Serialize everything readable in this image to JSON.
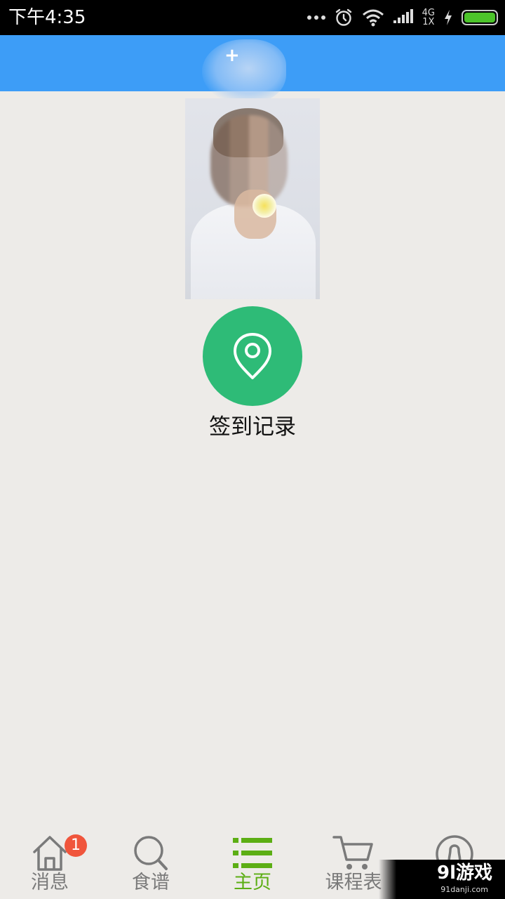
{
  "status_bar": {
    "time": "下午4:35",
    "network_top": "4G",
    "network_bottom": "1X",
    "icons": [
      "more-dots-icon",
      "alarm-icon",
      "wifi-icon",
      "signal-icon",
      "charging-icon",
      "battery-icon"
    ]
  },
  "header": {
    "title": "+"
  },
  "profile": {
    "photo": "profile-photo"
  },
  "checkin": {
    "icon": "location-pin-icon",
    "label": "签到记录",
    "color": "#2ebb77"
  },
  "nav": {
    "items": [
      {
        "label": "消息",
        "icon": "home-icon",
        "badge": "1",
        "active": false
      },
      {
        "label": "食谱",
        "icon": "search-icon",
        "active": false
      },
      {
        "label": "主页",
        "icon": "list-icon",
        "active": true
      },
      {
        "label": "课程表",
        "icon": "cart-icon",
        "active": false
      },
      {
        "label": "",
        "icon": "profile-icon",
        "active": false
      }
    ],
    "active_color": "#5cae14",
    "inactive_color": "#7a7a7a"
  },
  "watermark": {
    "text": "9l游戏",
    "sub": "91danji.com"
  },
  "colors": {
    "header_bg": "#3d9df7",
    "page_bg": "#edebe8",
    "badge": "#f0553c"
  }
}
